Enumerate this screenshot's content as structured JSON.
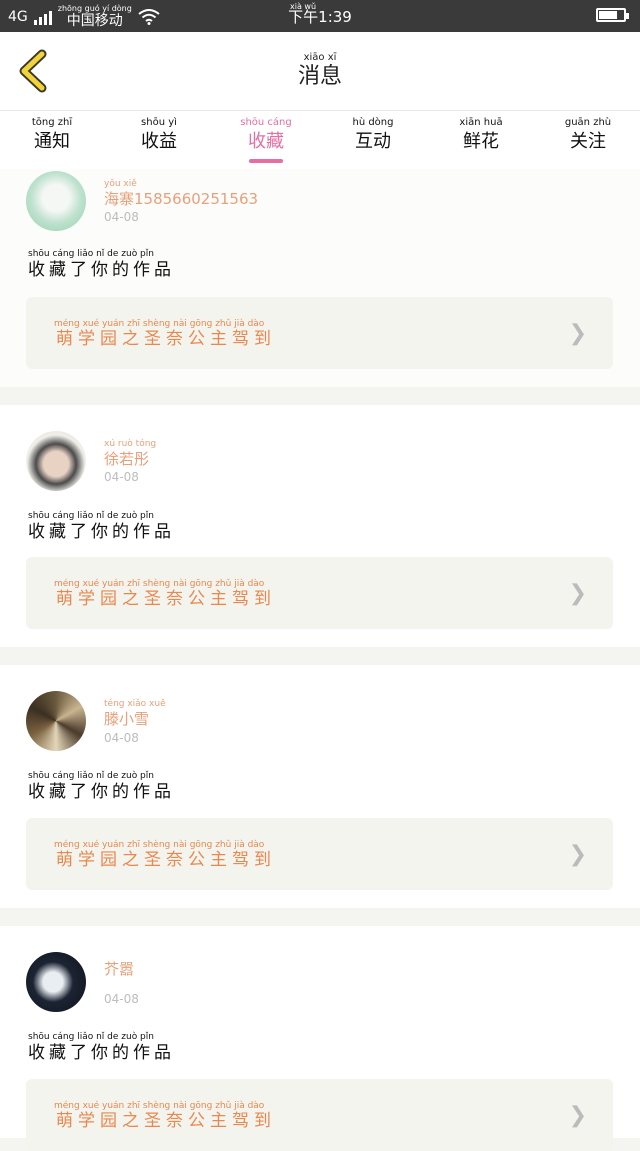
{
  "status_bar": {
    "network": "4G",
    "carrier_pinyin": "zhōng guó yí dòng",
    "carrier": "中国移动",
    "time_pinyin": "xià wǔ",
    "time": "下午1:39",
    "battery_level": 0.7
  },
  "header": {
    "title_pinyin": "xiāo xī",
    "title": "消息"
  },
  "tabs": [
    {
      "pinyin": "tōng zhī",
      "label": "通知"
    },
    {
      "pinyin": "shōu yì",
      "label": "收益"
    },
    {
      "pinyin": "shōu cáng",
      "label": "收藏",
      "active": true
    },
    {
      "pinyin": "hù dòng",
      "label": "互动"
    },
    {
      "pinyin": "xiān huā",
      "label": "鲜花"
    },
    {
      "pinyin": "guān zhù",
      "label": "关注"
    }
  ],
  "messages": [
    {
      "user_pinyin": "yǒu xiě",
      "user": "海寨15856602515​63",
      "date": "04-08",
      "text_pinyin": "shōu cáng liǎo nǐ de zuò pǐn",
      "text": "收藏了你的作品",
      "work_pinyin": "méng xué yuán zhī shèng nài gōng zhǔ jià dào",
      "work": "萌学园之圣奈公主驾到"
    },
    {
      "user_pinyin": "xú ruò tóng",
      "user": "徐若彤",
      "date": "04-08",
      "text_pinyin": "shōu cáng liǎo nǐ de zuò pǐn",
      "text": "收藏了你的作品",
      "work_pinyin": "méng xué yuán zhī shèng nài gōng zhǔ jià dào",
      "work": "萌学园之圣奈公主驾到"
    },
    {
      "user_pinyin": "téng xiǎo xuě",
      "user": "滕小雪",
      "date": "04-08",
      "text_pinyin": "shōu cáng liǎo nǐ de zuò pǐn",
      "text": "收藏了你的作品",
      "work_pinyin": "méng xué yuán zhī shèng nài gōng zhǔ jià dào",
      "work": "萌学园之圣奈公主驾到"
    },
    {
      "user_pinyin": "",
      "user": "芥嚣",
      "date": "04-08",
      "text_pinyin": "shōu cáng liǎo nǐ de zuò pǐn",
      "text": "收藏了你的作品",
      "work_pinyin": "méng xué yuán zhī shèng nài gōng zhǔ jià dào",
      "work": "萌学园之圣奈公主驾到"
    }
  ]
}
